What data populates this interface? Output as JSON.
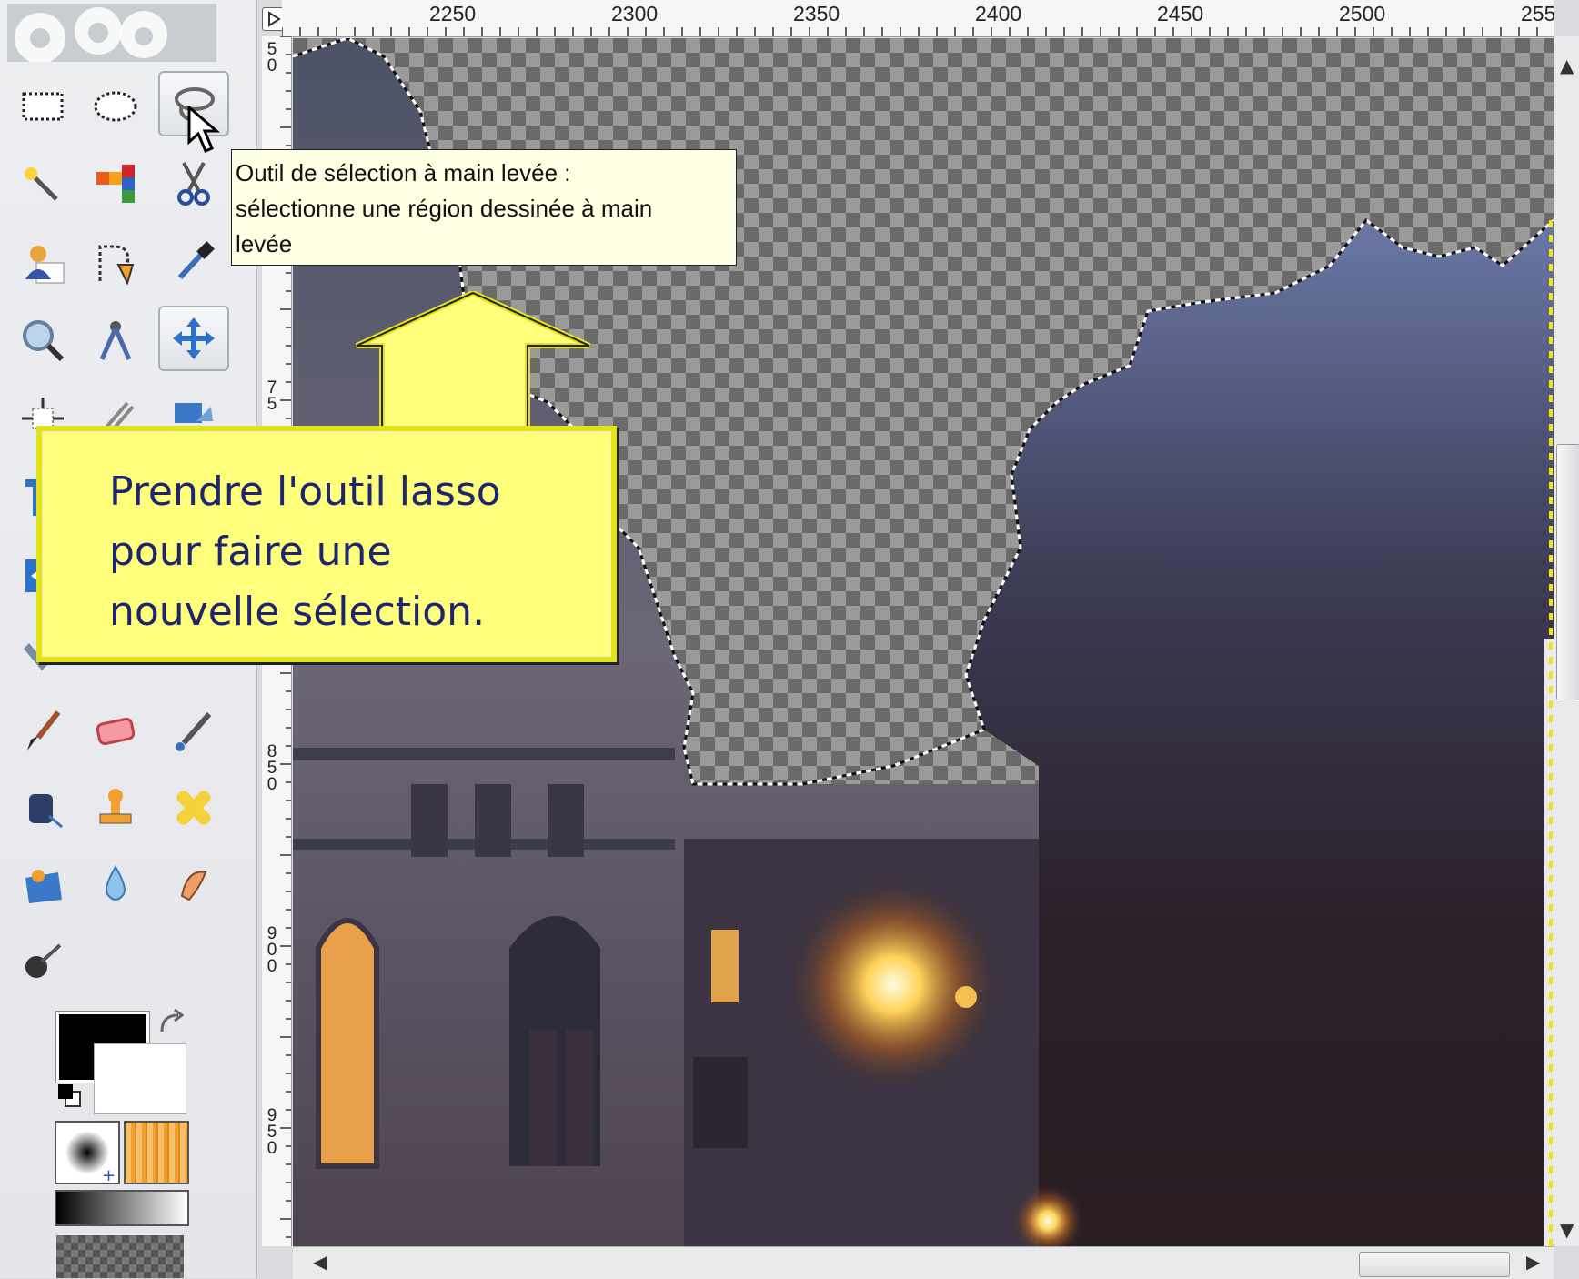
{
  "ruler": {
    "top_labels": [
      "2250",
      "2300",
      "2350",
      "2400",
      "2450",
      "2500",
      "255"
    ],
    "left_labels": [
      "5\n0",
      "7\n5",
      "8\n5\n0",
      "9\n0\n0",
      "9\n5\n0"
    ]
  },
  "tooltip": {
    "lines": [
      "Outil de sélection à main levée :",
      "sélectionne une région dessinée à main",
      "levée"
    ]
  },
  "callout": {
    "lines": [
      "Prendre l'outil lasso",
      "pour faire une",
      "nouvelle sélection."
    ]
  },
  "tools": [
    {
      "icon": "rect-select-icon"
    },
    {
      "icon": "ellipse-select-icon"
    },
    {
      "icon": "free-select-lasso-icon"
    },
    {
      "icon": "fuzzy-select-icon"
    },
    {
      "icon": "select-by-color-icon"
    },
    {
      "icon": "scissors-select-icon"
    },
    {
      "icon": "foreground-select-icon"
    },
    {
      "icon": "paths-icon"
    },
    {
      "icon": "color-picker-icon"
    },
    {
      "icon": "zoom-icon"
    },
    {
      "icon": "measure-icon"
    },
    {
      "icon": "move-icon"
    },
    {
      "icon": "paintbrush-icon"
    },
    {
      "icon": "eraser-icon"
    },
    {
      "icon": "airbrush-icon"
    },
    {
      "icon": "ink-icon"
    },
    {
      "icon": "clone-icon"
    },
    {
      "icon": "heal-icon"
    },
    {
      "icon": "perspective-clone-icon"
    },
    {
      "icon": "blur-icon"
    },
    {
      "icon": "smudge-icon"
    },
    {
      "icon": "dodge-burn-icon"
    }
  ],
  "colors": {
    "foreground": "#000000",
    "background": "#ffffff",
    "callout_fill": "#ffff7c",
    "callout_text": "#1d2570",
    "tooltip_fill": "#ffffe4"
  }
}
